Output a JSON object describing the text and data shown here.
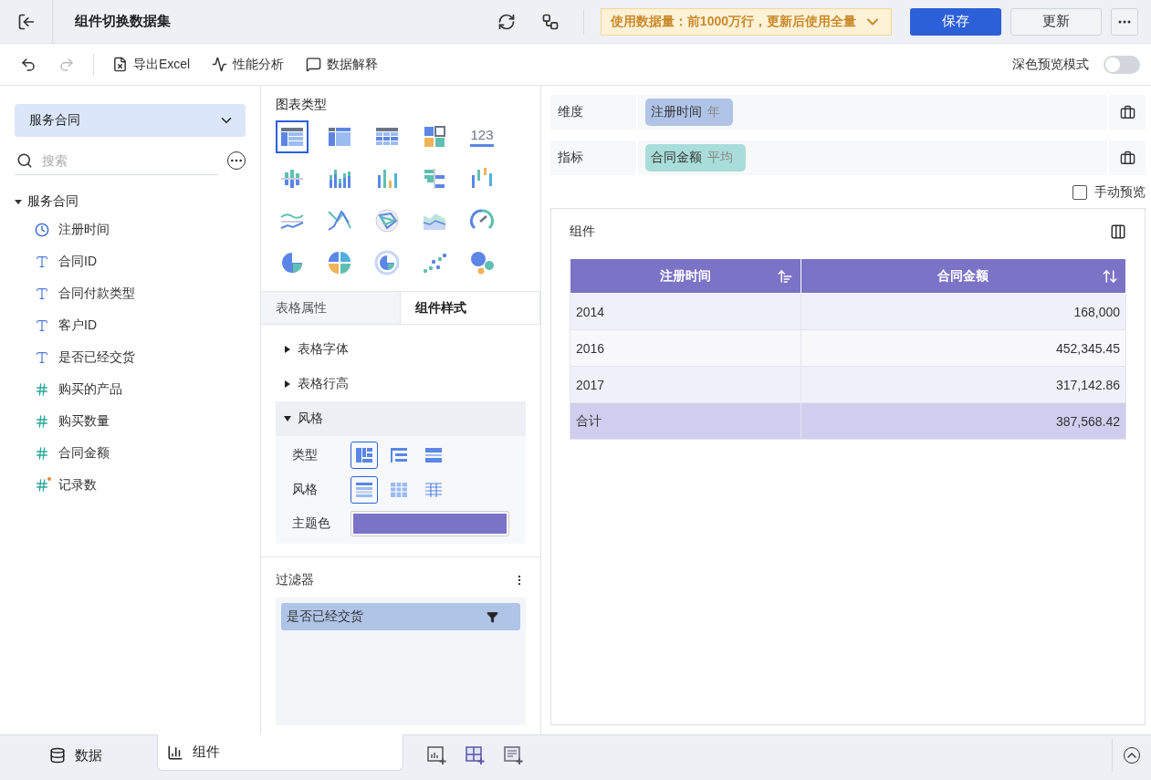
{
  "header": {
    "title": "组件切换数据集",
    "notice": "使用数据量：前1000万行，更新后使用全量",
    "save": "保存",
    "update": "更新"
  },
  "toolbar": {
    "items": [
      {
        "kind": "excel",
        "label": "导出Excel"
      },
      {
        "kind": "perf",
        "label": "性能分析"
      },
      {
        "kind": "explain",
        "label": "数据解释"
      }
    ],
    "dark_mode": {
      "label": "深色预览模式",
      "on": false
    }
  },
  "dataset": {
    "selector": "服务合同",
    "search": {
      "placeholder": "搜索"
    },
    "tree": {
      "label": "服务合同",
      "expanded": true,
      "children": [
        {
          "label": "注册时间",
          "kind": "date"
        },
        {
          "label": "合同ID",
          "kind": "text"
        },
        {
          "label": "合同付款类型",
          "kind": "text"
        },
        {
          "label": "客户ID",
          "kind": "text"
        },
        {
          "label": "是否已经交货",
          "kind": "text"
        },
        {
          "label": "购买的产品",
          "kind": "number"
        },
        {
          "label": "购买数量",
          "kind": "number"
        },
        {
          "label": "合同金额",
          "kind": "number"
        },
        {
          "label": "记录数",
          "kind": "count"
        }
      ]
    }
  },
  "chart_types": {
    "title": "图表类型",
    "items": [
      {
        "kind": "cross-table",
        "selected": true
      },
      {
        "kind": "group-table",
        "selected": false
      },
      {
        "kind": "detail-table",
        "selected": false
      },
      {
        "kind": "card",
        "selected": false
      },
      {
        "kind": "kpi",
        "label": "123",
        "selected": false
      },
      {
        "kind": "diverging-bar",
        "selected": false
      },
      {
        "kind": "stacked-bar",
        "selected": false
      },
      {
        "kind": "bar",
        "selected": false
      },
      {
        "kind": "bidirectional-bar",
        "selected": false
      },
      {
        "kind": "range-bar",
        "selected": false
      },
      {
        "kind": "line",
        "selected": false
      },
      {
        "kind": "cross-line",
        "selected": false
      },
      {
        "kind": "radar",
        "selected": false
      },
      {
        "kind": "area",
        "selected": false
      },
      {
        "kind": "gauge",
        "selected": false
      },
      {
        "kind": "pie",
        "selected": false
      },
      {
        "kind": "multi-pie",
        "selected": false
      },
      {
        "kind": "ring",
        "selected": false
      },
      {
        "kind": "scatter",
        "selected": false
      },
      {
        "kind": "bubble",
        "selected": false
      }
    ]
  },
  "property_tabs": [
    {
      "label": "表格属性",
      "selected": false
    },
    {
      "label": "组件样式",
      "selected": true
    }
  ],
  "sections": [
    {
      "label": "表格字体",
      "expanded": false
    },
    {
      "label": "表格行高",
      "expanded": false
    },
    {
      "label": "风格",
      "expanded": true
    }
  ],
  "style": {
    "type_label": "类型",
    "types": [
      {
        "kind": "cross",
        "selected": true
      },
      {
        "kind": "tree",
        "selected": false
      },
      {
        "kind": "expand",
        "selected": false
      }
    ],
    "style_label": "风格",
    "styles": [
      {
        "kind": "stripe",
        "selected": true
      },
      {
        "kind": "grid",
        "selected": false
      },
      {
        "kind": "lines",
        "selected": false
      }
    ],
    "theme": {
      "label": "主题色",
      "color": "#7b73c6"
    }
  },
  "filter": {
    "title": "过滤器",
    "items": [
      {
        "label": "是否已经交货"
      }
    ]
  },
  "fields": [
    {
      "label": "维度",
      "pill": "注册时间",
      "suffix": "年",
      "color": "#b0c4e8"
    },
    {
      "label": "指标",
      "pill": "合同金额",
      "suffix": "平均",
      "color": "#a8ddd9"
    }
  ],
  "manual_preview": {
    "label": "手动预览",
    "checked": false
  },
  "widget": {
    "title": "组件",
    "columns": [
      {
        "label": "注册时间",
        "kind": "sorted-ascending"
      },
      {
        "label": "合同金额",
        "kind": "unsorted"
      }
    ],
    "rows": [
      [
        "2014",
        "168,000"
      ],
      [
        "2016",
        "452,345.45"
      ],
      [
        "2017",
        "317,142.86"
      ]
    ],
    "total": [
      "合计",
      "387,568.42"
    ]
  },
  "bottom_tabs": [
    {
      "kind": "data",
      "label": "数据",
      "selected": false
    },
    {
      "kind": "widget",
      "label": "组件",
      "selected": true
    }
  ]
}
